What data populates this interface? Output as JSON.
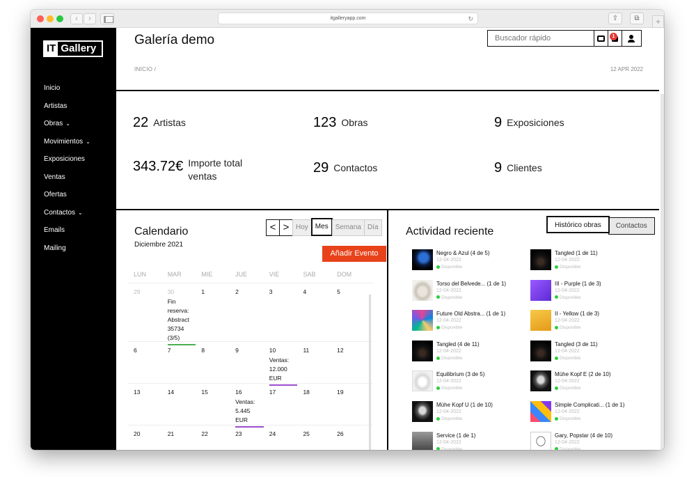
{
  "browser": {
    "url": "itgalleryapp.com"
  },
  "logo": {
    "it": "IT",
    "gallery": "Gallery"
  },
  "sidebar": {
    "items": [
      {
        "label": "Inicio",
        "chevron": false
      },
      {
        "label": "Artistas",
        "chevron": false
      },
      {
        "label": "Obras",
        "chevron": true
      },
      {
        "label": "Movimientos",
        "chevron": true
      },
      {
        "label": "Exposiciones",
        "chevron": false
      },
      {
        "label": "Ventas",
        "chevron": false
      },
      {
        "label": "Ofertas",
        "chevron": false
      },
      {
        "label": "Contactos",
        "chevron": true
      },
      {
        "label": "Emails",
        "chevron": false
      },
      {
        "label": "Mailing",
        "chevron": false
      }
    ]
  },
  "header": {
    "title": "Galería demo",
    "breadcrumb": "INICIO  /",
    "date": "12 APR 2022",
    "search_placeholder": "Buscador rápido",
    "notification_count": "1"
  },
  "stats": [
    {
      "value": "22",
      "label": "Artistas"
    },
    {
      "value": "123",
      "label": "Obras"
    },
    {
      "value": "9",
      "label": "Exposiciones"
    },
    {
      "value": "343.72€",
      "label": "Importe total ventas"
    },
    {
      "value": "29",
      "label": "Contactos"
    },
    {
      "value": "9",
      "label": "Clientes"
    }
  ],
  "calendar": {
    "title": "Calendario",
    "subtitle": "Diciembre 2021",
    "toolbar": {
      "prev": "<",
      "next": ">",
      "today": "Hoy",
      "month": "Mes",
      "week": "Semana",
      "day": "Día"
    },
    "add_event": "Añadir Evento",
    "day_names": [
      "LUN",
      "MAR",
      "MIE",
      "JUE",
      "VIE",
      "SAB",
      "DOM"
    ],
    "weeks": [
      {
        "days": [
          "29",
          "30",
          "1",
          "2",
          "3",
          "4",
          "5"
        ]
      },
      {
        "days": [
          "6",
          "7",
          "8",
          "9",
          "10",
          "11",
          "12"
        ]
      },
      {
        "days": [
          "13",
          "14",
          "15",
          "16",
          "17",
          "18",
          "19"
        ]
      },
      {
        "days": [
          "20",
          "21",
          "22",
          "23",
          "24",
          "25",
          "26"
        ]
      }
    ],
    "events": {
      "reserve": "Fin reserva: Abstract 35734 (3/5)",
      "sale1": "Ventas: 12.000 EUR",
      "sale2": "Ventas: 5.445 EUR"
    },
    "colors": {
      "reserve": "#4caf50",
      "sales": "#9c4dcc",
      "add_button": "#e8421a"
    }
  },
  "activity": {
    "title": "Actividad reciente",
    "tabs": [
      "Histórico obras",
      "Contactos"
    ],
    "items": [
      {
        "name": "Negro & Azul (4 de 5)",
        "date": "12-04-2022",
        "status": "Disponible",
        "thumb": "blue-black-portrait"
      },
      {
        "name": "Tangled (1 de 11)",
        "date": "12-04-2022",
        "status": "Disponible",
        "thumb": "dark-figure"
      },
      {
        "name": "Torso del Belvede... (1 de 1)",
        "date": "12-04-2022",
        "status": "Disponible",
        "thumb": "marble-torso"
      },
      {
        "name": "III - Purple (1 de 3)",
        "date": "12-04-2022",
        "status": "Disponible",
        "thumb": "purple-field"
      },
      {
        "name": "Future Old Abstra... (1 de 1)",
        "date": "12-04-2022",
        "status": "Disponible",
        "thumb": "colorful-abstract"
      },
      {
        "name": "II - Yellow (1 de 3)",
        "date": "12-04-2022",
        "status": "Disponible",
        "thumb": "yellow-field"
      },
      {
        "name": "Tangled (4 de 11)",
        "date": "12-04-2022",
        "status": "Disponible",
        "thumb": "dark-figure"
      },
      {
        "name": "Tangled (3 de 11)",
        "date": "12-04-2022",
        "status": "Disponible",
        "thumb": "dark-figure"
      },
      {
        "name": "Equilibrium (3 de 5)",
        "date": "12-04-2022",
        "status": "Disponible",
        "thumb": "white-sculpture"
      },
      {
        "name": "Mühe Kopf E (2 de 10)",
        "date": "12-04-2022",
        "status": "Disponible",
        "thumb": "mask-face"
      },
      {
        "name": "Mühe Kopf U (1 de 10)",
        "date": "12-04-2022",
        "status": "Disponible",
        "thumb": "mask-face"
      },
      {
        "name": "Simple Complicati... (1 de 1)",
        "date": "12-04-2022",
        "status": "Disponible",
        "thumb": "geometric-color"
      },
      {
        "name": "Service (1 de 1)",
        "date": "12-04-2022",
        "status": "Disponible",
        "thumb": "grey-photo"
      },
      {
        "name": "Gary, Popstar (4 de 10)",
        "date": "12-04-2022",
        "status": "Disponible",
        "thumb": "line-portrait"
      }
    ]
  }
}
